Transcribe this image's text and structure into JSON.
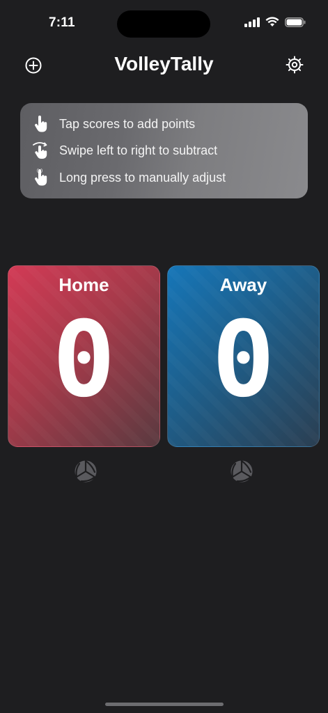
{
  "status_bar": {
    "time": "7:11"
  },
  "header": {
    "title": "VolleyTally",
    "add_icon": "plus-circle-icon",
    "settings_icon": "gear-icon"
  },
  "instructions": [
    {
      "icon": "tap-hand-icon",
      "text": "Tap scores to add points"
    },
    {
      "icon": "swipe-hand-icon",
      "text": "Swipe left to right to subtract"
    },
    {
      "icon": "long-press-hand-icon",
      "text": "Long press to manually adjust"
    }
  ],
  "teams": {
    "home": {
      "name": "Home",
      "score": "0",
      "color": "#d23a55"
    },
    "away": {
      "name": "Away",
      "score": "0",
      "color": "#1676b8"
    }
  },
  "serve_indicator_icon": "volleyball-icon"
}
